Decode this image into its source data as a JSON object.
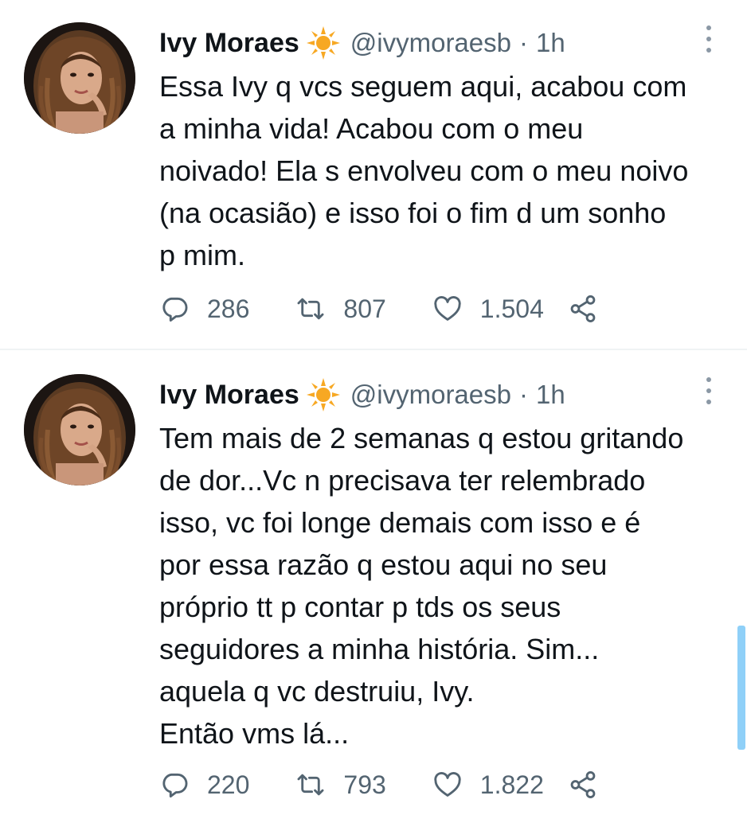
{
  "tweets": [
    {
      "author": {
        "name": "Ivy Moraes",
        "handle": "@ivymoraesb",
        "badge_icon": "sun-badge-icon"
      },
      "separator": "·",
      "time": "1h",
      "text": "Essa Ivy q vcs seguem aqui, acabou com\na minha vida! Acabou com o meu\nnoivado! Ela s envolveu com o meu noivo\n(na ocasião) e isso foi o fim d um sonho\np mim.",
      "replies": "286",
      "retweets": "807",
      "likes": "1.504"
    },
    {
      "author": {
        "name": "Ivy Moraes",
        "handle": "@ivymoraesb",
        "badge_icon": "sun-badge-icon"
      },
      "separator": "·",
      "time": "1h",
      "text": "Tem mais de 2 semanas q estou gritando\nde dor...Vc n precisava ter relembrado\nisso, vc foi longe demais com isso e é\npor essa razão q estou aqui no seu\npróprio tt p contar p tds os seus\nseguidores a minha história. Sim...\naquela q vc destruiu, Ivy.\nEntão vms lá...",
      "replies": "220",
      "retweets": "793",
      "likes": "1.822"
    }
  ],
  "colors": {
    "text": "#0f1419",
    "secondary": "#536471",
    "badge": "#f7a823",
    "scrollbar": "#8fd0f8"
  }
}
